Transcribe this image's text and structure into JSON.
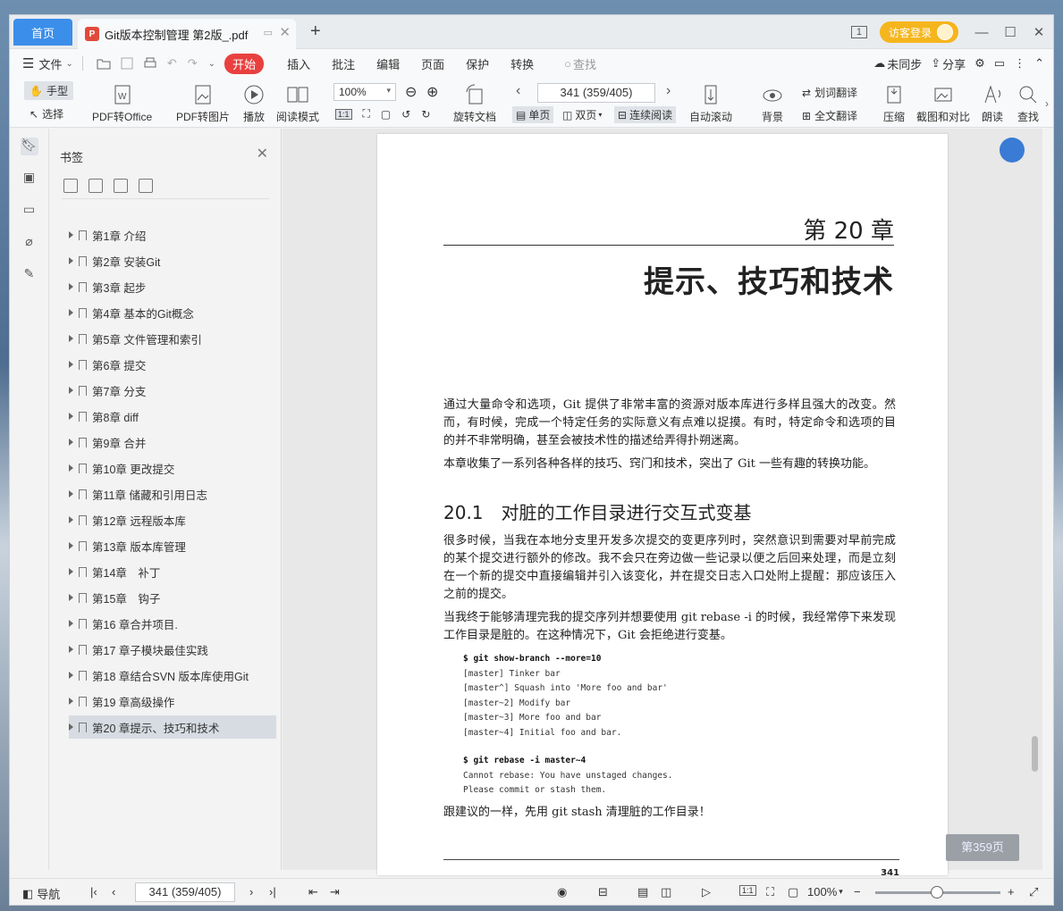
{
  "tabs": {
    "home": "首页",
    "doc": "Git版本控制管理 第2版_.pdf",
    "new": "+"
  },
  "titlebar": {
    "guest": "访客登录",
    "badge": "1"
  },
  "menu": {
    "file": "文件",
    "start": "开始",
    "items": [
      "插入",
      "批注",
      "编辑",
      "页面",
      "保护",
      "转换"
    ],
    "search": "查找",
    "unsync": "未同步",
    "share": "分享"
  },
  "toolbar": {
    "hand": "手型",
    "select": "选择",
    "pdf_office": "PDF转Office",
    "pdf_image": "PDF转图片",
    "play": "播放",
    "read_mode": "阅读模式",
    "zoom": "100%",
    "rotate": "旋转文档",
    "page_input": "341 (359/405)",
    "single": "单页",
    "double": "双页",
    "continuous": "连续阅读",
    "auto_scroll": "自动滚动",
    "background": "背景",
    "word_translate": "划词翻译",
    "full_translate": "全文翻译",
    "compress": "压缩",
    "screenshot": "截图和对比",
    "read_aloud": "朗读",
    "find": "查找"
  },
  "bookmarks": {
    "title": "书签",
    "items": [
      "第1章 介绍",
      "第2章 安装Git",
      "第3章 起步",
      "第4章 基本的Git概念",
      "第5章 文件管理和索引",
      "第6章 提交",
      "第7章 分支",
      "第8章 diff",
      "第9章 合并",
      "第10章 更改提交",
      "第11章 储藏和引用日志",
      "第12章 远程版本库",
      "第13章 版本库管理",
      "第14章　补丁",
      "第15章　钩子",
      "第16 章合并项目.",
      "第17 章子模块最佳实践",
      "第18 章结合SVN 版本库使用Git",
      "第19 章高级操作",
      "第20 章提示、技巧和技术"
    ]
  },
  "page": {
    "chapter_no": "第 20 章",
    "chapter_title": "提示、技巧和技术",
    "p1": "通过大量命令和选项，Git 提供了非常丰富的资源对版本库进行多样且强大的改变。然而，有时候，完成一个特定任务的实际意义有点难以捉摸。有时，特定命令和选项的目的并不非常明确，甚至会被技术性的描述给弄得扑朔迷离。",
    "p2": "本章收集了一系列各种各样的技巧、窍门和技术，突出了 Git 一些有趣的转换功能。",
    "section": "20.1　对脏的工作目录进行交互式变基",
    "p3": "很多时候，当我在本地分支里开发多次提交的变更序列时，突然意识到需要对早前完成的某个提交进行额外的修改。我不会只在旁边做一些记录以便之后回来处理，而是立刻在一个新的提交中直接编辑并引入该变化，并在提交日志入口处附上提醒：那应该压入之前的提交。",
    "p4": "当我终于能够清理完我的提交序列并想要使用 git rebase -i 的时候，我经常停下来发现工作目录是脏的。在这种情况下，Git 会拒绝进行变基。",
    "code1_cmd": "$ git show-branch --more=10",
    "code1_lines": [
      "[master] Tinker bar",
      "[master^] Squash into 'More foo and bar'",
      "[master~2] Modify bar",
      "[master~3] More foo and bar",
      "[master~4] Initial foo and bar."
    ],
    "code2_cmd": "$ git rebase -i master~4",
    "code2_lines": [
      "Cannot rebase: You have unstaged changes.",
      "Please commit or stash them."
    ],
    "p5": "跟建议的一样，先用 git stash 清理脏的工作目录！",
    "page_number": "341",
    "badge": "第359页"
  },
  "status": {
    "nav": "导航",
    "page": "341 (359/405)",
    "zoom": "100%"
  }
}
